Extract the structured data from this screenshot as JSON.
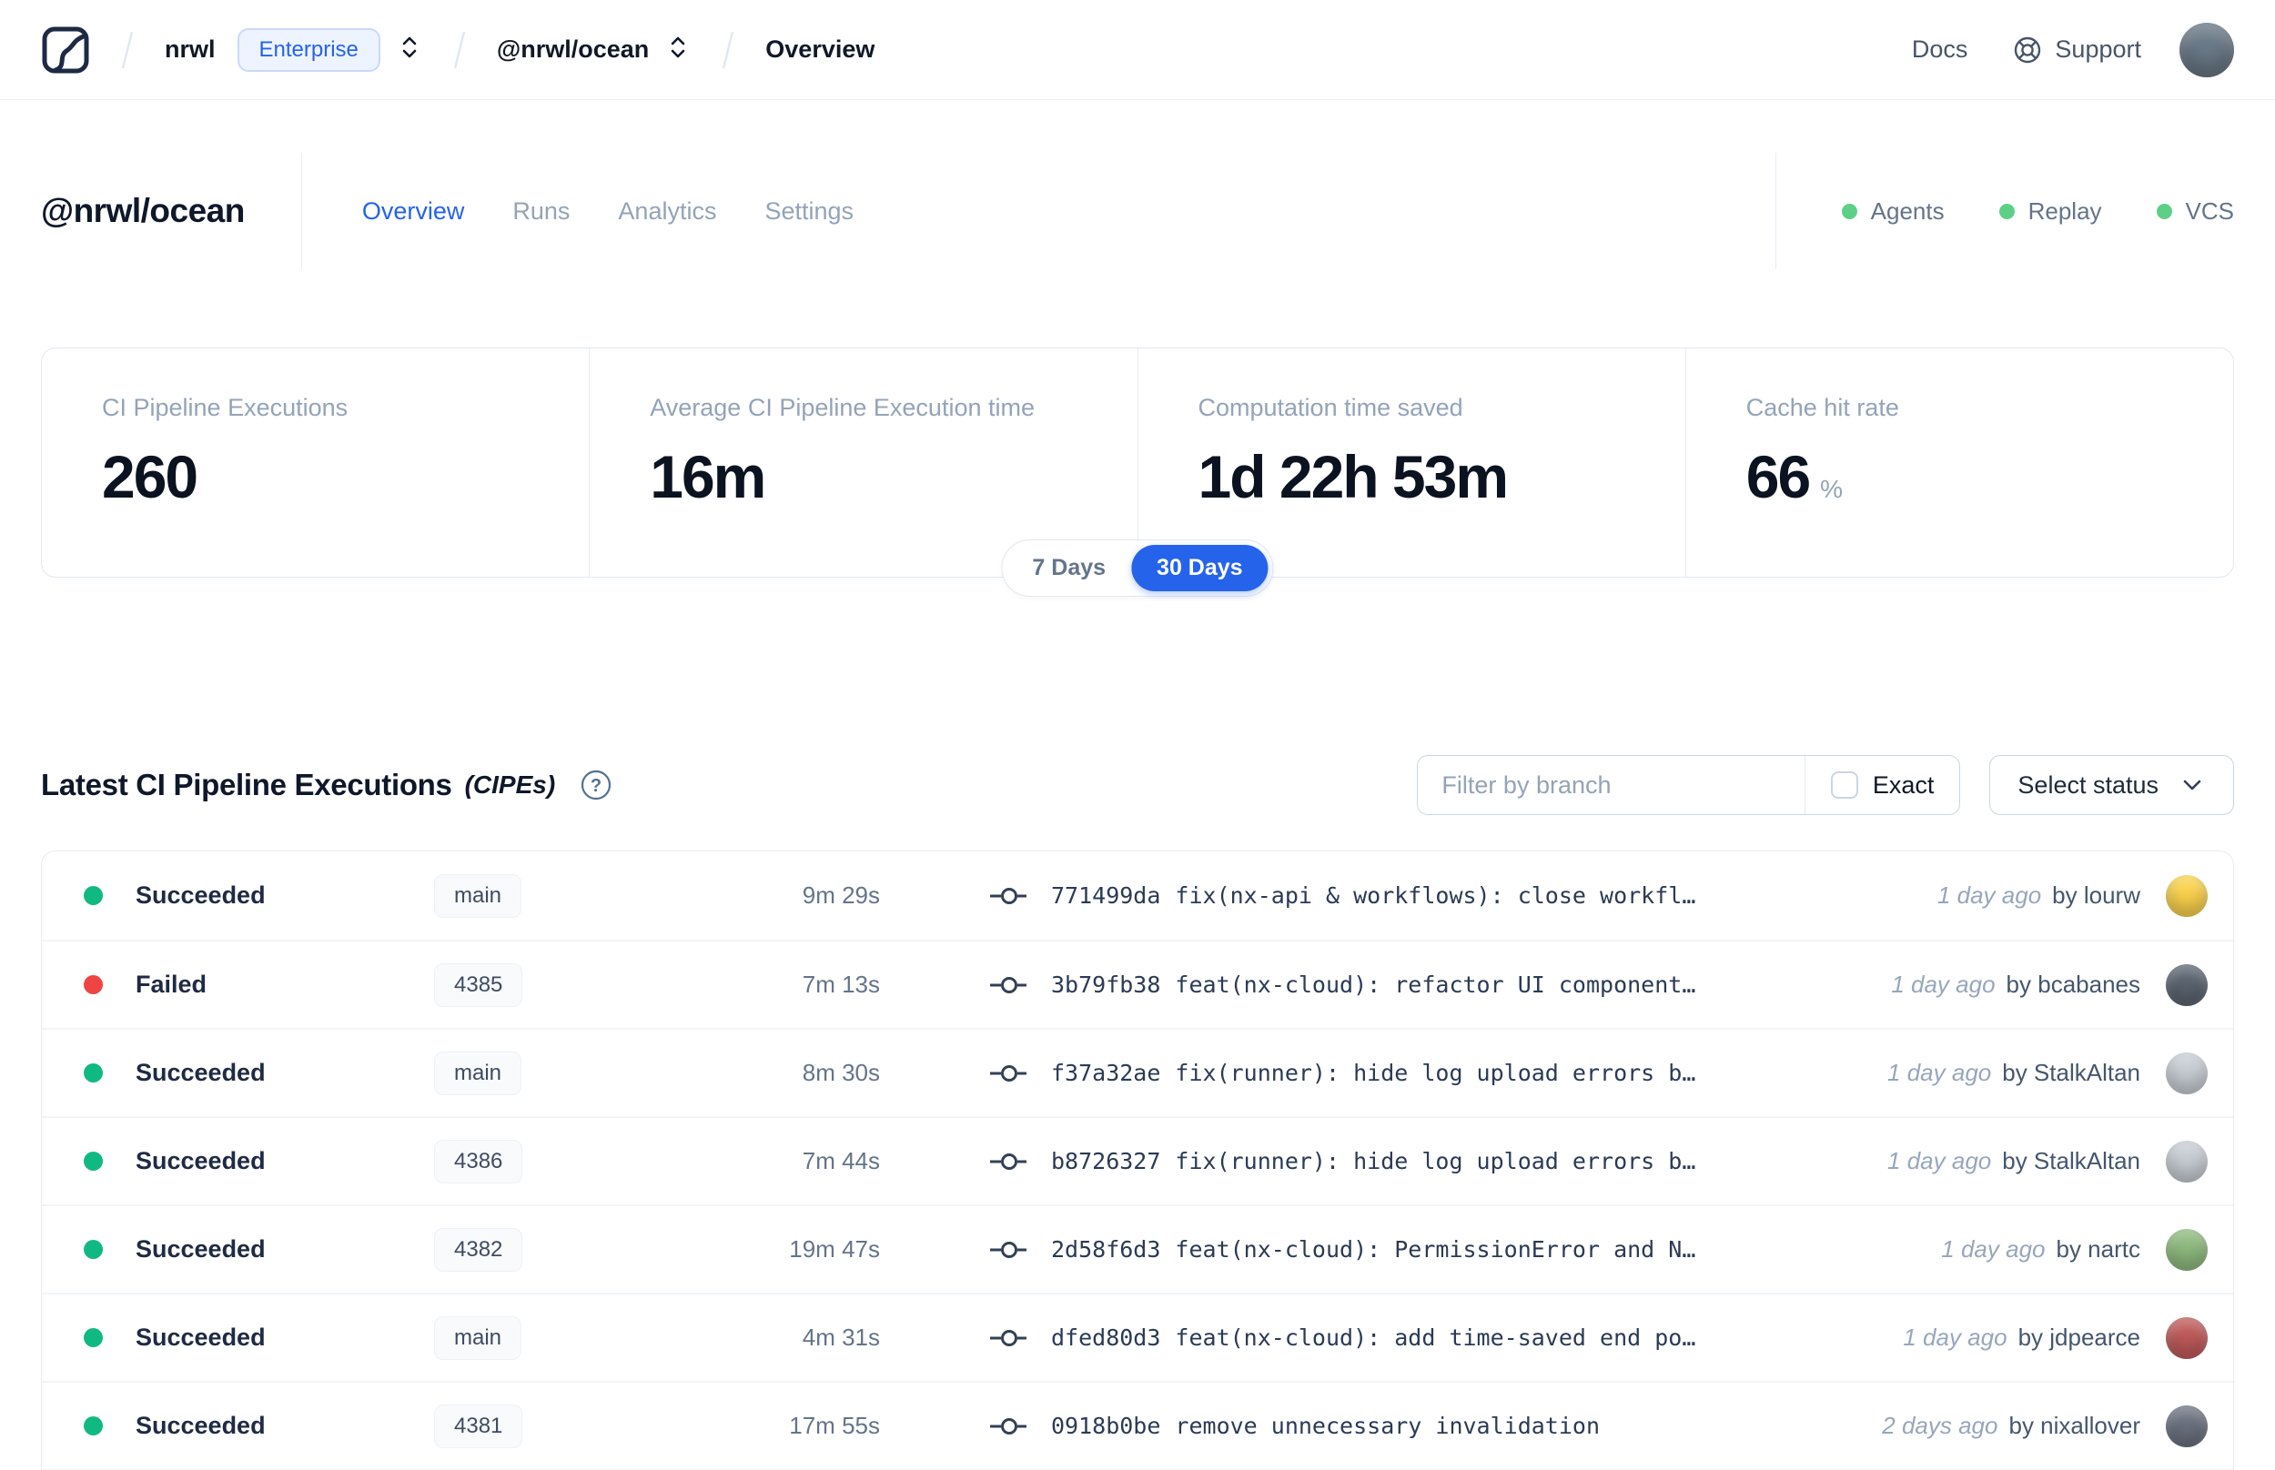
{
  "colors": {
    "accent_blue": "#2563eb",
    "indicator_green": "#5cd087",
    "succeeded_green": "#10b981",
    "failed_red": "#ef4444"
  },
  "navbar": {
    "org": "nrwl",
    "org_badge": "Enterprise",
    "workspace": "@nrwl/ocean",
    "page": "Overview",
    "docs": "Docs",
    "support": "Support",
    "avatar_color": "#6b7a88"
  },
  "workspace_header": {
    "title": "@nrwl/ocean",
    "tabs": [
      {
        "label": "Overview",
        "active": true
      },
      {
        "label": "Runs",
        "active": false
      },
      {
        "label": "Analytics",
        "active": false
      },
      {
        "label": "Settings",
        "active": false
      }
    ],
    "indicators": [
      {
        "label": "Agents"
      },
      {
        "label": "Replay"
      },
      {
        "label": "VCS"
      }
    ]
  },
  "stats": {
    "cards": [
      {
        "label": "CI Pipeline Executions",
        "value": "260"
      },
      {
        "label": "Average CI Pipeline Execution time",
        "value": "16m"
      },
      {
        "label": "Computation time saved",
        "value": "1d 22h 53m"
      },
      {
        "label": "Cache hit rate",
        "value": "66",
        "unit": "%"
      }
    ],
    "period": {
      "options": [
        {
          "label": "7 Days",
          "active": false
        },
        {
          "label": "30 Days",
          "active": true
        }
      ]
    }
  },
  "cipes": {
    "title": "Latest CI Pipeline Executions",
    "title_suffix": "(CIPEs)",
    "filter_placeholder": "Filter by branch",
    "exact_label": "Exact",
    "select_status_label": "Select status",
    "rows": [
      {
        "status": "Succeeded",
        "status_color": "#10b981",
        "branch": "main",
        "duration": "9m 29s",
        "commit_hash": "771499da",
        "commit_message": "fix(nx-api & workflows): close workfl…",
        "time": "1 day ago",
        "author": "by lourw",
        "avatar_color": "#fcd34d"
      },
      {
        "status": "Failed",
        "status_color": "#ef4444",
        "branch": "4385",
        "duration": "7m 13s",
        "commit_hash": "3b79fb38",
        "commit_message": "feat(nx-cloud): refactor UI component…",
        "time": "1 day ago",
        "author": "by bcabanes",
        "avatar_color": "#5b6470"
      },
      {
        "status": "Succeeded",
        "status_color": "#10b981",
        "branch": "main",
        "duration": "8m 30s",
        "commit_hash": "f37a32ae",
        "commit_message": "fix(runner): hide log upload errors b…",
        "time": "1 day ago",
        "author": "by StalkAltan",
        "avatar_color": "#c9cfd6"
      },
      {
        "status": "Succeeded",
        "status_color": "#10b981",
        "branch": "4386",
        "duration": "7m 44s",
        "commit_hash": "b8726327",
        "commit_message": "fix(runner): hide log upload errors b…",
        "time": "1 day ago",
        "author": "by StalkAltan",
        "avatar_color": "#c9cfd6"
      },
      {
        "status": "Succeeded",
        "status_color": "#10b981",
        "branch": "4382",
        "duration": "19m 47s",
        "commit_hash": "2d58f6d3",
        "commit_message": "feat(nx-cloud): PermissionError and N…",
        "time": "1 day ago",
        "author": "by nartc",
        "avatar_color": "#8fbb7f"
      },
      {
        "status": "Succeeded",
        "status_color": "#10b981",
        "branch": "main",
        "duration": "4m 31s",
        "commit_hash": "dfed80d3",
        "commit_message": "feat(nx-cloud): add time-saved end po…",
        "time": "1 day ago",
        "author": "by jdpearce",
        "avatar_color": "#c05a5a"
      },
      {
        "status": "Succeeded",
        "status_color": "#10b981",
        "branch": "4381",
        "duration": "17m 55s",
        "commit_hash": "0918b0be",
        "commit_message": "remove unnecessary invalidation",
        "time": "2 days ago",
        "author": "by nixallover",
        "avatar_color": "#6b7280"
      }
    ]
  }
}
